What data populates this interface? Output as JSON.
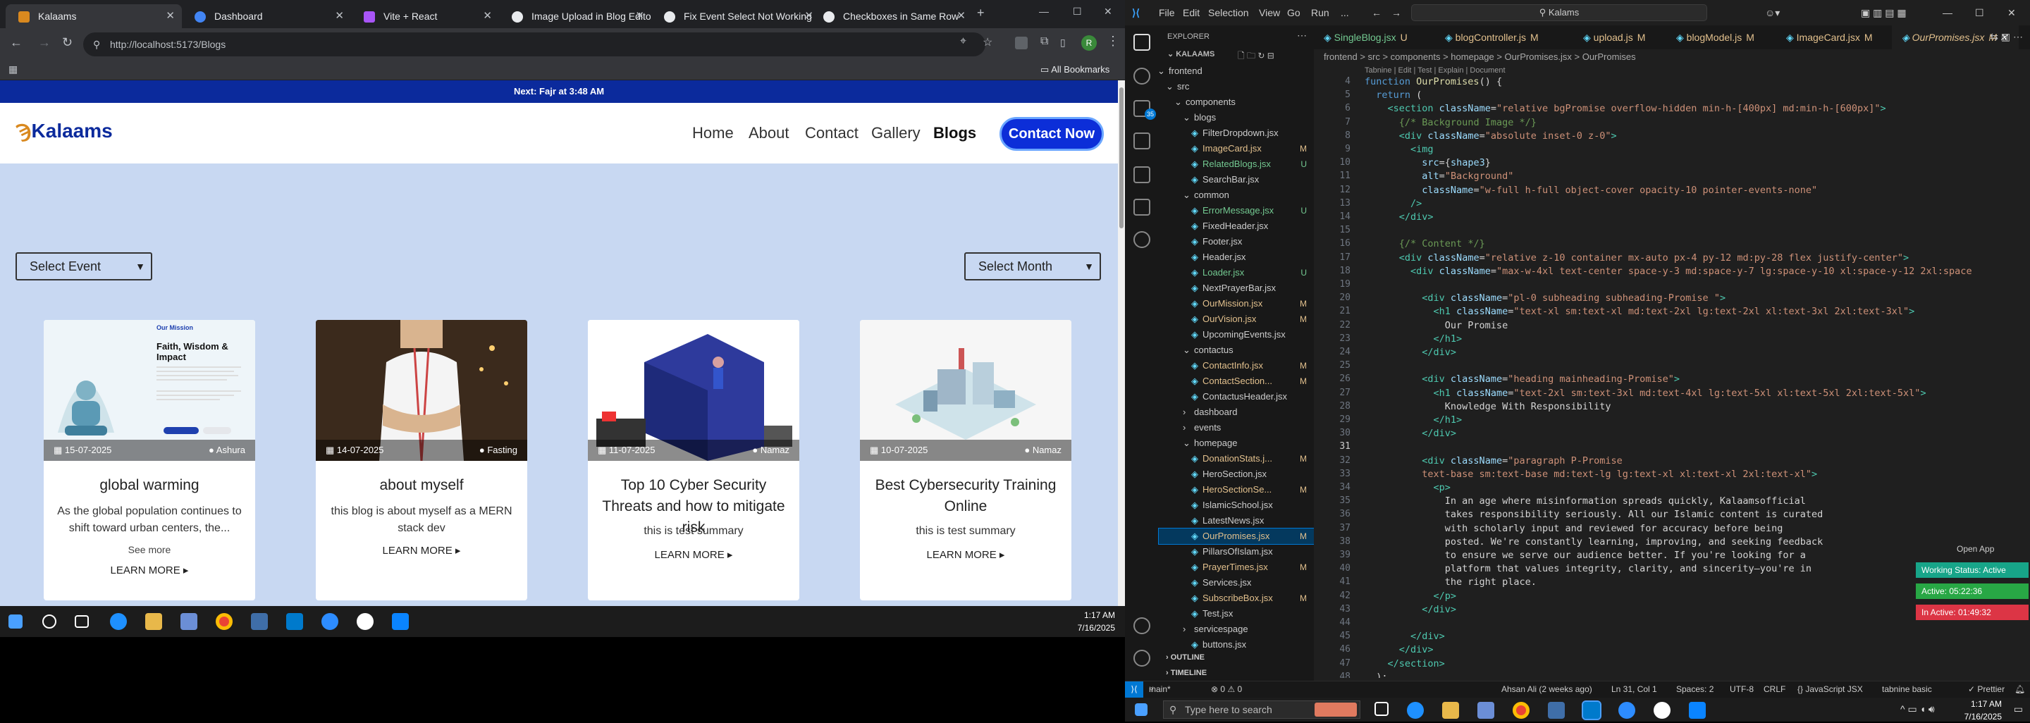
{
  "browser": {
    "tabs": [
      {
        "title": "Kalaams",
        "favicon_color": "#d9891f"
      },
      {
        "title": "Dashboard",
        "favicon_color": "#4285f4"
      },
      {
        "title": "Vite + React",
        "favicon_color": "#a855f7"
      },
      {
        "title": "Image Upload in Blog Editor",
        "favicon_color": "#e8eaed"
      },
      {
        "title": "Fix Event Select Not Working",
        "favicon_color": "#e8eaed"
      },
      {
        "title": "Checkboxes in Same Row",
        "favicon_color": "#e8eaed"
      }
    ],
    "url": "http://localhost:5173/Blogs",
    "all_bookmarks": "All Bookmarks",
    "profile_initial": "R"
  },
  "site": {
    "topbar_text": "Next: Fajr at 3:48 AM",
    "logo_text": "Kalaams",
    "nav": [
      "Home",
      "About",
      "Contact",
      "Gallery",
      "Blogs"
    ],
    "contact_button": "Contact Now",
    "select_event": "Select Event",
    "select_month": "Select Month",
    "cards": [
      {
        "date": "15-07-2025",
        "category": "Ashura",
        "title": "global warming",
        "desc": "As the global population continues to shift toward urban centers, the...",
        "see_more": "See more",
        "learn_more": "LEARN MORE",
        "img_heading": "Our Mission",
        "img_title": "Faith, Wisdom & Impact"
      },
      {
        "date": "14-07-2025",
        "category": "Fasting",
        "title": "about myself",
        "desc": "this blog is about myself as a MERN stack dev",
        "learn_more": "LEARN MORE"
      },
      {
        "date": "11-07-2025",
        "category": "Namaz",
        "title": "Top 10 Cyber Security Threats and how to mitigate risk",
        "desc": "this is test summary",
        "learn_more": "LEARN MORE"
      },
      {
        "date": "10-07-2025",
        "category": "Namaz",
        "title": "Best Cybersecurity Training Online",
        "desc": "this is test summary",
        "learn_more": "LEARN MORE"
      }
    ],
    "brand_colors": {
      "primary": "#0b2a9c",
      "button": "#0c2ed8",
      "page_bg": "#c8d8f2"
    }
  },
  "taskbar_left": {
    "time": "1:17 AM",
    "date": "7/16/2025"
  },
  "vscode": {
    "menu": [
      "File",
      "Edit",
      "Selection",
      "View",
      "Go",
      "Run",
      "..."
    ],
    "search": "Kalams",
    "explorer_title": "EXPLORER",
    "workspace": "KALAAMS",
    "tree": [
      {
        "name": "frontend",
        "indent": 1,
        "type": "folder",
        "status": ""
      },
      {
        "name": "src",
        "indent": 2,
        "type": "folder",
        "status": ""
      },
      {
        "name": "components",
        "indent": 3,
        "type": "folder",
        "status": ""
      },
      {
        "name": "blogs",
        "indent": 4,
        "type": "folder",
        "status": ""
      },
      {
        "name": "FilterDropdown.jsx",
        "indent": 5,
        "type": "file",
        "status": ""
      },
      {
        "name": "ImageCard.jsx",
        "indent": 5,
        "type": "file",
        "status": "M"
      },
      {
        "name": "RelatedBlogs.jsx",
        "indent": 5,
        "type": "file",
        "status": "U"
      },
      {
        "name": "SearchBar.jsx",
        "indent": 5,
        "type": "file",
        "status": ""
      },
      {
        "name": "common",
        "indent": 4,
        "type": "folder",
        "status": ""
      },
      {
        "name": "ErrorMessage.jsx",
        "indent": 5,
        "type": "file",
        "status": "U"
      },
      {
        "name": "FixedHeader.jsx",
        "indent": 5,
        "type": "file",
        "status": ""
      },
      {
        "name": "Footer.jsx",
        "indent": 5,
        "type": "file",
        "status": ""
      },
      {
        "name": "Header.jsx",
        "indent": 5,
        "type": "file",
        "status": ""
      },
      {
        "name": "Loader.jsx",
        "indent": 5,
        "type": "file",
        "status": "U"
      },
      {
        "name": "NextPrayerBar.jsx",
        "indent": 5,
        "type": "file",
        "status": ""
      },
      {
        "name": "OurMission.jsx",
        "indent": 5,
        "type": "file",
        "status": "M"
      },
      {
        "name": "OurVision.jsx",
        "indent": 5,
        "type": "file",
        "status": "M"
      },
      {
        "name": "UpcomingEvents.jsx",
        "indent": 5,
        "type": "file",
        "status": ""
      },
      {
        "name": "contactus",
        "indent": 4,
        "type": "folder",
        "status": ""
      },
      {
        "name": "ContactInfo.jsx",
        "indent": 5,
        "type": "file",
        "status": "M"
      },
      {
        "name": "ContactSection...",
        "indent": 5,
        "type": "file",
        "status": "M"
      },
      {
        "name": "ContactusHeader.jsx",
        "indent": 5,
        "type": "file",
        "status": ""
      },
      {
        "name": "dashboard",
        "indent": 4,
        "type": "folder-closed",
        "status": ""
      },
      {
        "name": "events",
        "indent": 4,
        "type": "folder-closed",
        "status": ""
      },
      {
        "name": "homepage",
        "indent": 4,
        "type": "folder",
        "status": ""
      },
      {
        "name": "DonationStats.j...",
        "indent": 5,
        "type": "file",
        "status": "M"
      },
      {
        "name": "HeroSection.jsx",
        "indent": 5,
        "type": "file",
        "status": ""
      },
      {
        "name": "HeroSectionSe...",
        "indent": 5,
        "type": "file",
        "status": "M"
      },
      {
        "name": "IslamicSchool.jsx",
        "indent": 5,
        "type": "file",
        "status": ""
      },
      {
        "name": "LatestNews.jsx",
        "indent": 5,
        "type": "file",
        "status": ""
      },
      {
        "name": "OurPromises.jsx",
        "indent": 5,
        "type": "file",
        "status": "M",
        "selected": true
      },
      {
        "name": "PillarsOfIslam.jsx",
        "indent": 5,
        "type": "file",
        "status": ""
      },
      {
        "name": "PrayerTimes.jsx",
        "indent": 5,
        "type": "file",
        "status": "M"
      },
      {
        "name": "Services.jsx",
        "indent": 5,
        "type": "file",
        "status": ""
      },
      {
        "name": "SubscribeBox.jsx",
        "indent": 5,
        "type": "file",
        "status": "M"
      },
      {
        "name": "Test.jsx",
        "indent": 5,
        "type": "file",
        "status": ""
      },
      {
        "name": "servicespage",
        "indent": 4,
        "type": "folder-closed",
        "status": ""
      },
      {
        "name": "buttons.jsx",
        "indent": 5,
        "type": "file",
        "status": ""
      }
    ],
    "outline": "OUTLINE",
    "timeline": "TIMELINE",
    "editor_tabs": [
      {
        "name": "SingleBlog.jsx",
        "status": "U"
      },
      {
        "name": "blogController.js",
        "status": "M"
      },
      {
        "name": "upload.js",
        "status": "M"
      },
      {
        "name": "blogModel.js",
        "status": "M"
      },
      {
        "name": "ImageCard.jsx",
        "status": "M"
      },
      {
        "name": "OurPromises.jsx",
        "status": "M",
        "active": true
      }
    ],
    "breadcrumb": "frontend > src > components > homepage > OurPromises.jsx > OurPromises",
    "codelens": "Tabnine | Edit | Test | Explain | Document",
    "first_line": 4,
    "code": [
      [
        [
          "kw",
          "function "
        ],
        [
          "fn",
          "OurPromises"
        ],
        [
          "tx",
          "() {"
        ]
      ],
      [
        [
          "kw",
          "  return "
        ],
        [
          "tx",
          "("
        ]
      ],
      [
        [
          "tx",
          "    "
        ],
        [
          "tg",
          "<section "
        ],
        [
          "at",
          "className"
        ],
        [
          "tx",
          "="
        ],
        [
          "st",
          "\"relative bgPromise overflow-hidden min-h-[400px] md:min-h-[600px]\""
        ],
        [
          "tg",
          ">"
        ]
      ],
      [
        [
          "tx",
          "      "
        ],
        [
          "cm",
          "{/* Background Image */}"
        ]
      ],
      [
        [
          "tx",
          "      "
        ],
        [
          "tg",
          "<div "
        ],
        [
          "at",
          "className"
        ],
        [
          "tx",
          "="
        ],
        [
          "st",
          "\"absolute inset-0 z-0\""
        ],
        [
          "tg",
          ">"
        ]
      ],
      [
        [
          "tx",
          "        "
        ],
        [
          "tg",
          "<img"
        ]
      ],
      [
        [
          "tx",
          "          "
        ],
        [
          "at",
          "src"
        ],
        [
          "tx",
          "={"
        ],
        [
          "at",
          "shape3"
        ],
        [
          "tx",
          "}"
        ]
      ],
      [
        [
          "tx",
          "          "
        ],
        [
          "at",
          "alt"
        ],
        [
          "tx",
          "="
        ],
        [
          "st",
          "\"Background\""
        ]
      ],
      [
        [
          "tx",
          "          "
        ],
        [
          "at",
          "className"
        ],
        [
          "tx",
          "="
        ],
        [
          "st",
          "\"w-full h-full object-cover opacity-10 pointer-events-none\""
        ]
      ],
      [
        [
          "tx",
          "        "
        ],
        [
          "tg",
          "/>"
        ]
      ],
      [
        [
          "tx",
          "      "
        ],
        [
          "tg",
          "</div>"
        ]
      ],
      [
        [
          "tx",
          ""
        ]
      ],
      [
        [
          "tx",
          "      "
        ],
        [
          "cm",
          "{/* Content */}"
        ]
      ],
      [
        [
          "tx",
          "      "
        ],
        [
          "tg",
          "<div "
        ],
        [
          "at",
          "className"
        ],
        [
          "tx",
          "="
        ],
        [
          "st",
          "\"relative z-10 container mx-auto px-4 py-12 md:py-28 flex justify-center\""
        ],
        [
          "tg",
          ">"
        ]
      ],
      [
        [
          "tx",
          "        "
        ],
        [
          "tg",
          "<div "
        ],
        [
          "at",
          "className"
        ],
        [
          "tx",
          "="
        ],
        [
          "st",
          "\"max-w-4xl text-center space-y-3 md:space-y-7 lg:space-y-10 xl:space-y-12 2xl:space"
        ]
      ],
      [
        [
          "tx",
          ""
        ]
      ],
      [
        [
          "tx",
          "          "
        ],
        [
          "tg",
          "<div "
        ],
        [
          "at",
          "className"
        ],
        [
          "tx",
          "="
        ],
        [
          "st",
          "\"pl-0 subheading subheading-Promise \""
        ],
        [
          "tg",
          ">"
        ]
      ],
      [
        [
          "tx",
          "            "
        ],
        [
          "tg",
          "<h1 "
        ],
        [
          "at",
          "className"
        ],
        [
          "tx",
          "="
        ],
        [
          "st",
          "\"text-xl sm:text-xl md:text-2xl lg:text-2xl xl:text-3xl 2xl:text-3xl\""
        ],
        [
          "tg",
          ">"
        ]
      ],
      [
        [
          "tx",
          "              Our Promise"
        ]
      ],
      [
        [
          "tx",
          "            "
        ],
        [
          "tg",
          "</h1>"
        ]
      ],
      [
        [
          "tx",
          "          "
        ],
        [
          "tg",
          "</div>"
        ]
      ],
      [
        [
          "tx",
          ""
        ]
      ],
      [
        [
          "tx",
          "          "
        ],
        [
          "tg",
          "<div "
        ],
        [
          "at",
          "className"
        ],
        [
          "tx",
          "="
        ],
        [
          "st",
          "\"heading mainheading-Promise\""
        ],
        [
          "tg",
          ">"
        ]
      ],
      [
        [
          "tx",
          "            "
        ],
        [
          "tg",
          "<h1 "
        ],
        [
          "at",
          "className"
        ],
        [
          "tx",
          "="
        ],
        [
          "st",
          "\"text-2xl sm:text-3xl md:text-4xl lg:text-5xl xl:text-5xl 2xl:text-5xl\""
        ],
        [
          "tg",
          ">"
        ]
      ],
      [
        [
          "tx",
          "              Knowledge With Responsibility"
        ]
      ],
      [
        [
          "tx",
          "            "
        ],
        [
          "tg",
          "</h1>"
        ]
      ],
      [
        [
          "tx",
          "          "
        ],
        [
          "tg",
          "</div>"
        ]
      ],
      [
        [
          "tx",
          ""
        ]
      ],
      [
        [
          "tx",
          "          "
        ],
        [
          "tg",
          "<div "
        ],
        [
          "at",
          "className"
        ],
        [
          "tx",
          "="
        ],
        [
          "st",
          "\"paragraph P-Promise"
        ]
      ],
      [
        [
          "st",
          "          text-base sm:text-base md:text-lg lg:text-xl xl:text-xl 2xl:text-xl\""
        ],
        [
          "tg",
          ">"
        ]
      ],
      [
        [
          "tx",
          "            "
        ],
        [
          "tg",
          "<p>"
        ]
      ],
      [
        [
          "tx",
          "              In an age where misinformation spreads quickly, Kalaamsofficial"
        ]
      ],
      [
        [
          "tx",
          "              takes responsibility seriously. All our Islamic content is curated"
        ]
      ],
      [
        [
          "tx",
          "              with scholarly input and reviewed for accuracy before being"
        ]
      ],
      [
        [
          "tx",
          "              posted. We're constantly learning, improving, and seeking feedback"
        ]
      ],
      [
        [
          "tx",
          "              to ensure we serve our audience better. If you're looking for a"
        ]
      ],
      [
        [
          "tx",
          "              platform that values integrity, clarity, and sincerity—you're in"
        ]
      ],
      [
        [
          "tx",
          "              the right place."
        ]
      ],
      [
        [
          "tx",
          "            "
        ],
        [
          "tg",
          "</p>"
        ]
      ],
      [
        [
          "tx",
          "          "
        ],
        [
          "tg",
          "</div>"
        ]
      ],
      [
        [
          "tx",
          ""
        ]
      ],
      [
        [
          "tx",
          "        "
        ],
        [
          "tg",
          "</div>"
        ]
      ],
      [
        [
          "tx",
          "      "
        ],
        [
          "tg",
          "</div>"
        ]
      ],
      [
        [
          "tx",
          "    "
        ],
        [
          "tg",
          "</section>"
        ]
      ],
      [
        [
          "tx",
          "  );"
        ]
      ]
    ],
    "status_bar": {
      "branch": "main*",
      "problems": "⊗ 0 ⚠ 0",
      "author": "Ahsan Ali (2 weeks ago)",
      "position": "Ln 31, Col 1",
      "spaces": "Spaces: 2",
      "encoding": "UTF-8",
      "eol": "CRLF",
      "language": "{} JavaScript JSX",
      "tabnine": "tabnine basic",
      "prettier": "✓ Prettier"
    },
    "open_app": "Open App",
    "working_status": "Working Status: Active",
    "active_time": "Active: 05:22:36",
    "inactive_time": "In Active: 01:49:32"
  },
  "taskbar_right": {
    "search_placeholder": "Type here to search",
    "time": "1:17 AM",
    "date": "7/16/2025"
  }
}
